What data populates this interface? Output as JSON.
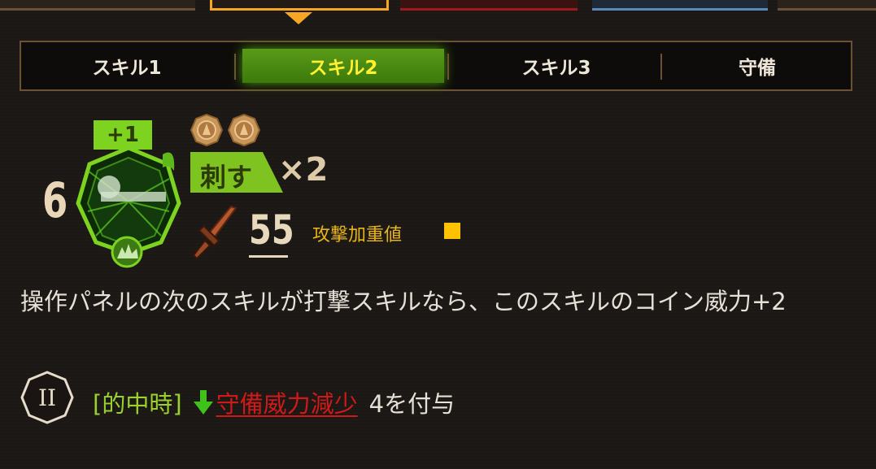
{
  "tabs": [
    {
      "label": "スキル1",
      "active": false
    },
    {
      "label": "スキル2",
      "active": true
    },
    {
      "label": "スキル3",
      "active": false
    },
    {
      "label": "守備",
      "active": false
    }
  ],
  "skill": {
    "level": "6",
    "bonus": "+1",
    "coin_count": 2,
    "attack_type": "刺す",
    "multiplier": "×2",
    "power": "55",
    "weight_label": "攻撃加重値",
    "weight_pips": 1,
    "description": "操作パネルの次のスキルが打撃スキルなら、このスキルのコイン威力+2",
    "effect": {
      "coin_label": "II",
      "condition": "[的中時]",
      "status_name": "守備威力減少",
      "status_rest": "4を付与"
    }
  },
  "colors": {
    "accent_green": "#7ed321",
    "weight_yellow": "#ffc200",
    "debuff_red": "#d01a1a",
    "tab_active_text": "#fff12e"
  },
  "icons": [
    "coin-icon",
    "sword-icon",
    "down-arrow-icon",
    "skill-emblem-icon"
  ]
}
